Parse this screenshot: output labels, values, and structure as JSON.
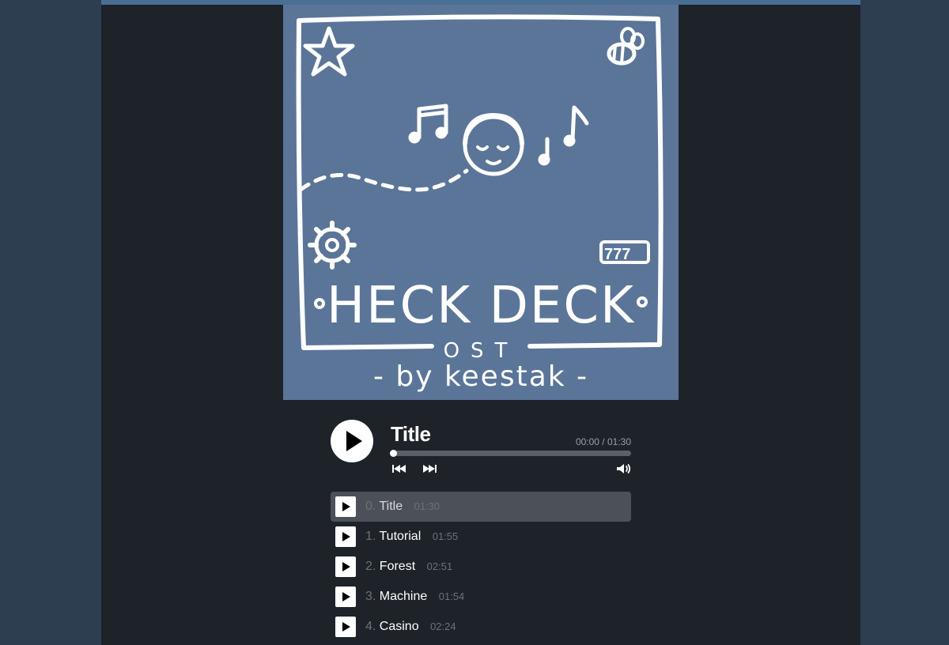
{
  "player": {
    "now_playing": "Title",
    "time_display": "00:00 / 01:30",
    "progress": 0.0
  },
  "icons": {
    "play": "play-icon",
    "previous": "skip-previous-icon",
    "next": "skip-next-icon",
    "volume": "volume-icon"
  },
  "colors": {
    "page_bg": "#2c3e50",
    "column_bg": "#1e2229",
    "cover_bg": "#5b7598",
    "active_row": "#4c5058",
    "muted_text": "#6c727b"
  },
  "tracks": [
    {
      "num": "0.",
      "name": "Title",
      "duration": "01:30",
      "active": true
    },
    {
      "num": "1.",
      "name": "Tutorial",
      "duration": "01:55",
      "active": false
    },
    {
      "num": "2.",
      "name": "Forest",
      "duration": "02:51",
      "active": false
    },
    {
      "num": "3.",
      "name": "Machine",
      "duration": "01:54",
      "active": false
    },
    {
      "num": "4.",
      "name": "Casino",
      "duration": "02:24",
      "active": false
    }
  ]
}
